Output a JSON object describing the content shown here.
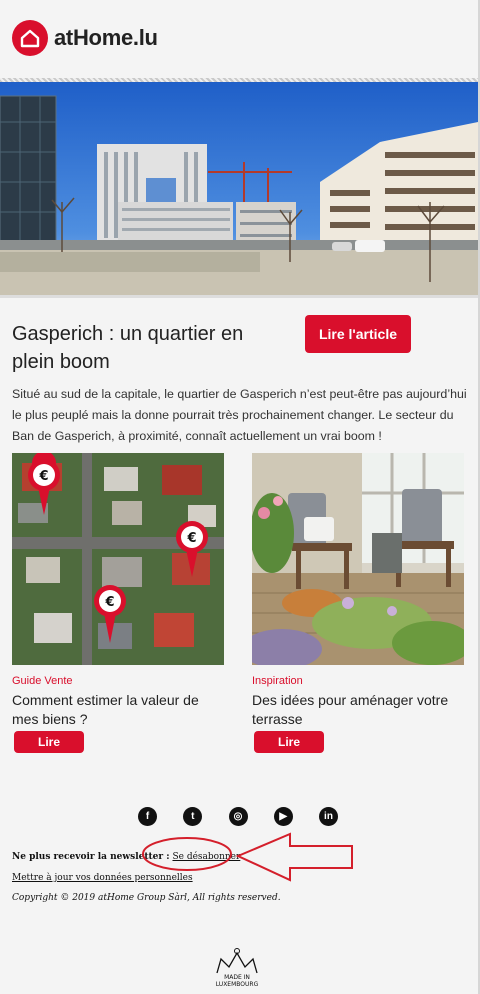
{
  "brand": {
    "name": "atHome.lu",
    "color": "#d90f2c"
  },
  "header": {
    "logo_icon": "house-icon"
  },
  "article": {
    "title": "Gasperich : un quartier en plein boom",
    "cta_label": "Lire l'article",
    "intro": "Situé au sud de la capitale, le quartier de Gasperich n’est peut-être pas aujourd’hui le plus peuplé mais la donne pourrait très prochainement changer. Le secteur du Ban de Gasperich, à proximité, connaît actuellement un vrai boom !"
  },
  "cards": [
    {
      "category": "Guide Vente",
      "title": "Comment estimer la valeur de mes biens ?",
      "button": "Lire"
    },
    {
      "category": "Inspiration",
      "title": "Des idées pour aménager votre terrasse",
      "button": "Lire"
    }
  ],
  "social": [
    {
      "icon": "facebook-icon",
      "glyph": "f"
    },
    {
      "icon": "twitter-icon",
      "glyph": "t"
    },
    {
      "icon": "instagram-icon",
      "glyph": "◎"
    },
    {
      "icon": "youtube-icon",
      "glyph": "▶"
    },
    {
      "icon": "linkedin-icon",
      "glyph": "in"
    }
  ],
  "footer": {
    "unsubscribe_prefix": "Ne plus recevoir la newsletter :",
    "unsubscribe_link": "Se désabonner",
    "update_link": "Mettre à jour vos données personnelles",
    "copyright": "Copyright © 2019 atHome Group Sàrl, All rights reserved."
  },
  "badge": {
    "line1": "MADE IN",
    "line2": "LUXEMBOURG"
  }
}
